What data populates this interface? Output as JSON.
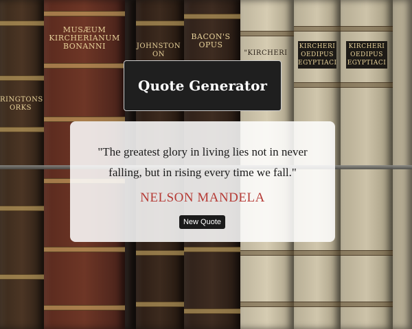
{
  "background": {
    "spines": [
      {
        "text": "RINGTONS\nORKS"
      },
      {
        "text": "MUSÆUM\nKIRCHERIANUM\nBONANNI"
      },
      {
        "text": "JOHNSTON\nON"
      },
      {
        "text": "BACON'S\nOPUS"
      },
      {
        "text": "\"KIRCHERI"
      },
      {
        "text": "KIRCHERI\nOEDIPUS\nEGYPTIACI"
      },
      {
        "text": "KIRCHERI\nOEDIPUS\nEGYPTIACI"
      }
    ]
  },
  "header": {
    "title": "Quote Generator"
  },
  "quote_card": {
    "quote": "\"The greatest glory in living lies not in never falling, but in rising every time we fall.\"",
    "author": "NELSON MANDELA",
    "new_quote_label": "New Quote"
  }
}
